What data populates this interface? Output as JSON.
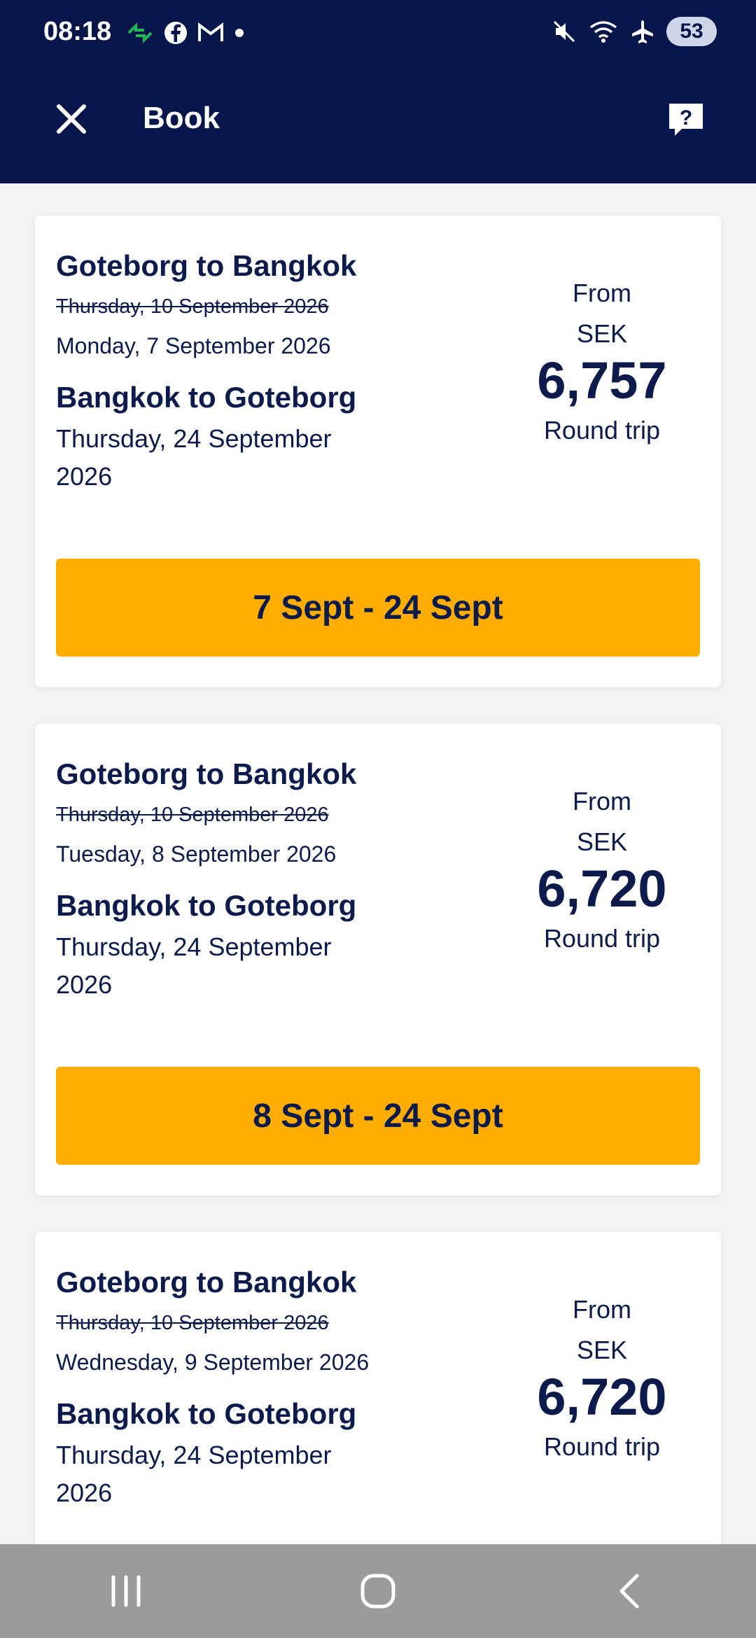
{
  "status_bar": {
    "time": "08:18",
    "battery": "53",
    "left_icons": [
      "sync-icon",
      "facebook-icon",
      "gmail-icon",
      "dot-icon"
    ],
    "right_icons": [
      "mute-icon",
      "wifi-icon",
      "airplane-icon"
    ]
  },
  "header": {
    "title": "Book",
    "close_icon": "close-icon",
    "help_icon": "help-icon"
  },
  "cards": [
    {
      "outbound_title": "Goteborg to Bangkok",
      "original_date": "Thursday, 10 September 2026",
      "outbound_date": "Monday, 7 September 2026",
      "return_title": "Bangkok to Goteborg",
      "return_date": "Thursday, 24 September 2026",
      "from_label": "From",
      "currency": "SEK",
      "price": "6,757",
      "trip_type": "Round trip",
      "button_label": "7 Sept - 24 Sept"
    },
    {
      "outbound_title": "Goteborg to Bangkok",
      "original_date": "Thursday, 10 September 2026",
      "outbound_date": "Tuesday, 8 September 2026",
      "return_title": "Bangkok to Goteborg",
      "return_date": "Thursday, 24 September 2026",
      "from_label": "From",
      "currency": "SEK",
      "price": "6,720",
      "trip_type": "Round trip",
      "button_label": "8 Sept - 24 Sept"
    },
    {
      "outbound_title": "Goteborg to Bangkok",
      "original_date": "Thursday, 10 September 2026",
      "outbound_date": "Wednesday, 9 September 2026",
      "return_title": "Bangkok to Goteborg",
      "return_date": "Thursday, 24 September 2026",
      "from_label": "From",
      "currency": "SEK",
      "price": "6,720",
      "trip_type": "Round trip"
    }
  ],
  "colors": {
    "header_bg": "#07164a",
    "accent_button": "#ffad00",
    "text_primary": "#0c1b4c"
  },
  "nav": [
    "recent-apps-icon",
    "home-icon",
    "back-icon"
  ]
}
